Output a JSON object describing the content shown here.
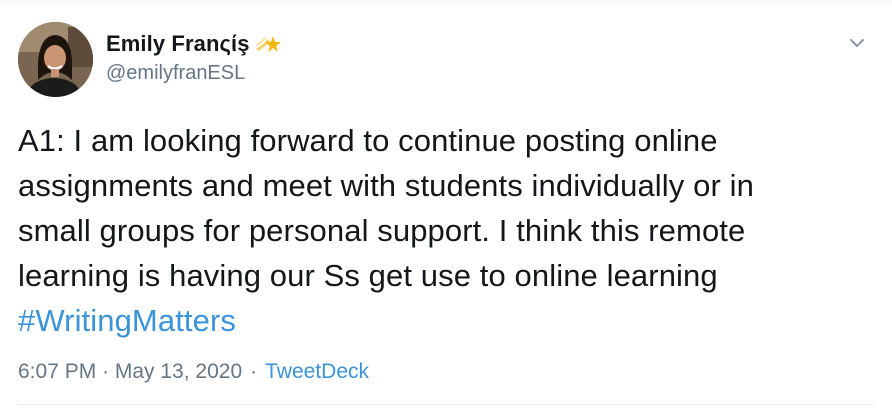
{
  "tweet": {
    "author": {
      "display_name": "Emily Franςίş",
      "handle": "@emilyfranESL",
      "name_emoji_icon": "shooting-star-icon",
      "avatar_icon": "profile-photo"
    },
    "menu_icon": "chevron-down-icon",
    "text_lines": [
      "A1: I am looking forward to continue posting online",
      "assignments and meet with students individually or in",
      "small groups for personal support. I think this remote",
      "learning is having our Ss get use to online learning"
    ],
    "hashtag": "#WritingMatters",
    "timestamp": "6:07 PM · May 13, 2020",
    "separator": "·",
    "source": "TweetDeck",
    "colors": {
      "link": "#3b94d9",
      "text": "#14171a",
      "muted": "#657786",
      "star": "#f5b70a"
    }
  }
}
